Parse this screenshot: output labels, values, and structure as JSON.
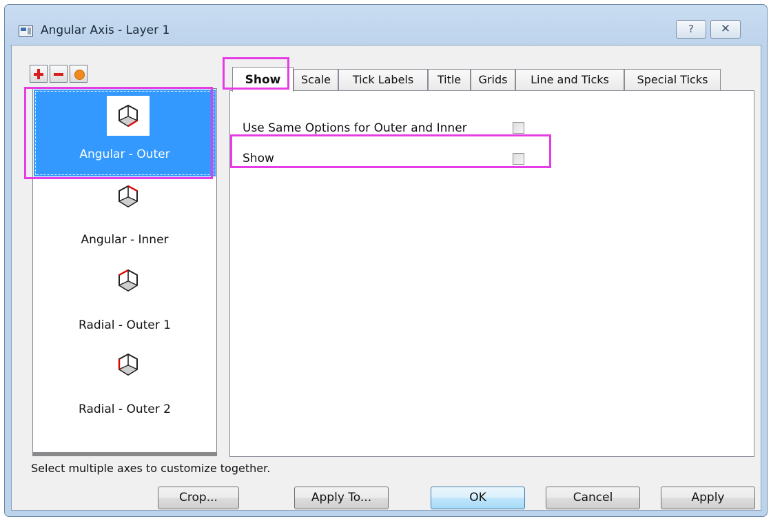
{
  "window": {
    "title": "Angular Axis - Layer 1",
    "help_glyph": "?",
    "close_glyph": "✕"
  },
  "toolbar": {
    "add_icon": "plus-icon",
    "remove_icon": "minus-icon",
    "dot_icon": "orange-dot-icon"
  },
  "axes": [
    {
      "label": "Angular - Outer",
      "icon": "axis-cube-icon",
      "selected": true
    },
    {
      "label": "Angular - Inner",
      "icon": "axis-cube-icon",
      "selected": false
    },
    {
      "label": "Radial - Outer 1",
      "icon": "axis-cube-icon",
      "selected": false
    },
    {
      "label": "Radial - Outer 2",
      "icon": "axis-cube-icon",
      "selected": false
    }
  ],
  "tabs": [
    "Show",
    "Scale",
    "Tick Labels",
    "Title",
    "Grids",
    "Line and Ticks",
    "Special Ticks"
  ],
  "active_tab": "Show",
  "options": [
    {
      "label": "Use Same Options for Outer and Inner",
      "checked": false
    },
    {
      "label": "Show",
      "checked": false
    }
  ],
  "hint": "Select multiple axes to customize together.",
  "buttons": {
    "crop": "Crop...",
    "apply_to": "Apply To...",
    "ok": "OK",
    "cancel": "Cancel",
    "apply": "Apply"
  },
  "colors": {
    "selection": "#3399ff",
    "highlight": "#e63ce6",
    "accent_red": "#d61e1e"
  }
}
